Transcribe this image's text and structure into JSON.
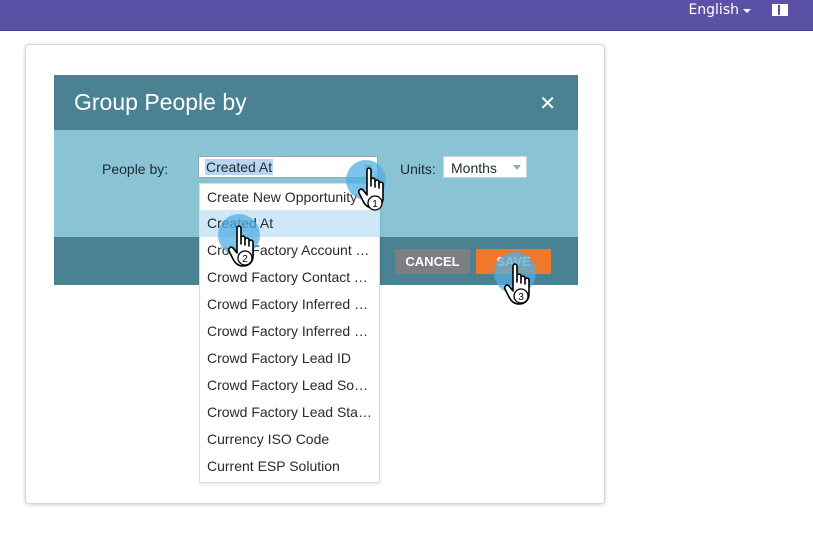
{
  "topbar": {
    "language": "English",
    "layout_icon": "layout-toggle-icon"
  },
  "dialog": {
    "title": "Group People by",
    "close_icon": "close-icon",
    "people_by_label": "People by:",
    "people_by_value": "Created At",
    "units_label": "Units:",
    "units_value": "Months",
    "cancel_label": "CANCEL",
    "save_label": "SAVE"
  },
  "dropdown": {
    "items": [
      "Create New Opportunity",
      "Created At",
      "Crowd Factory Account Type",
      "Crowd Factory Contact Type",
      "Crowd Factory Inferred City",
      "Crowd Factory Inferred Country",
      "Crowd Factory Lead ID",
      "Crowd Factory Lead Source",
      "Crowd Factory Lead Status",
      "Currency ISO Code",
      "Current ESP Solution"
    ],
    "selected_index": 1
  },
  "callouts": {
    "step1": "1",
    "step2": "2",
    "step3": "3",
    "icon": "pointer-hand-icon"
  }
}
